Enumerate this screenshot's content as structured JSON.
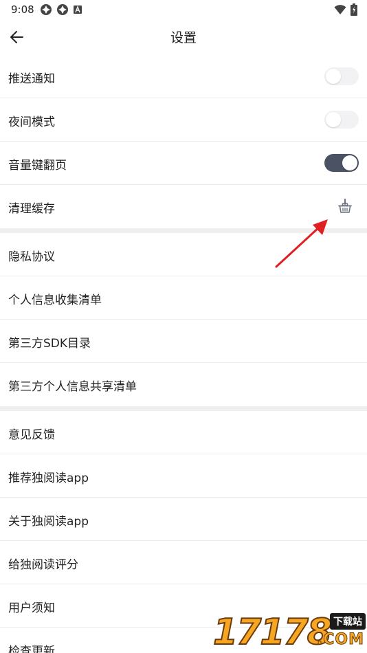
{
  "status_bar": {
    "time": "9:08",
    "left_icons": [
      "app-notification-icon",
      "app-notification-icon",
      "a-badge-icon"
    ],
    "right_icons": [
      "wifi-icon",
      "battery-charging-icon"
    ]
  },
  "header": {
    "title": "设置",
    "back_icon": "arrow-left-icon"
  },
  "groups": [
    {
      "items": [
        {
          "label": "推送通知",
          "control": "toggle",
          "on": false
        },
        {
          "label": "夜间模式",
          "control": "toggle",
          "on": false
        },
        {
          "label": "音量键翻页",
          "control": "toggle",
          "on": true
        },
        {
          "label": "清理缓存",
          "control": "icon",
          "icon": "broom-basket-icon"
        }
      ]
    },
    {
      "items": [
        {
          "label": "隐私协议"
        },
        {
          "label": "个人信息收集清单"
        },
        {
          "label": "第三方SDK目录"
        },
        {
          "label": "第三方个人信息共享清单"
        }
      ]
    },
    {
      "items": [
        {
          "label": "意见反馈"
        },
        {
          "label": "推荐独阅读app"
        },
        {
          "label": "关于独阅读app"
        },
        {
          "label": "给独阅读评分"
        },
        {
          "label": "用户须知"
        },
        {
          "label": "检查更新"
        }
      ]
    }
  ],
  "colors": {
    "toggle_on": "#4b5263",
    "toggle_off": "#f2f2f4",
    "divider": "#ececec",
    "group_gap": "#efefef",
    "annotation_arrow": "#e02020"
  },
  "watermark": {
    "digits": "17178",
    "badge": "下载站",
    "suffix": ".COM"
  }
}
